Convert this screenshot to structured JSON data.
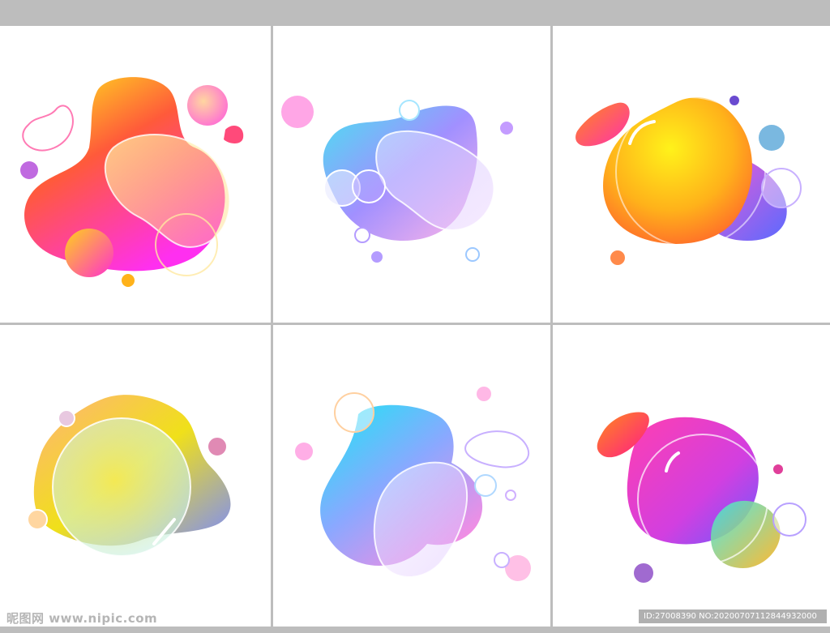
{
  "watermark": {
    "site": "昵图网 www.nipic.com",
    "id_label": "ID:27008390 NO:20200707112844932000"
  },
  "colors": {
    "background_gray": "#bdbdbd",
    "panel_white": "#ffffff",
    "yellow": "#ffe81a",
    "magenta": "#ff2fd0",
    "orange": "#ff6a2a",
    "cyan": "#3fe6f0",
    "violet": "#8e7bff",
    "pink": "#ff7ad6"
  }
}
